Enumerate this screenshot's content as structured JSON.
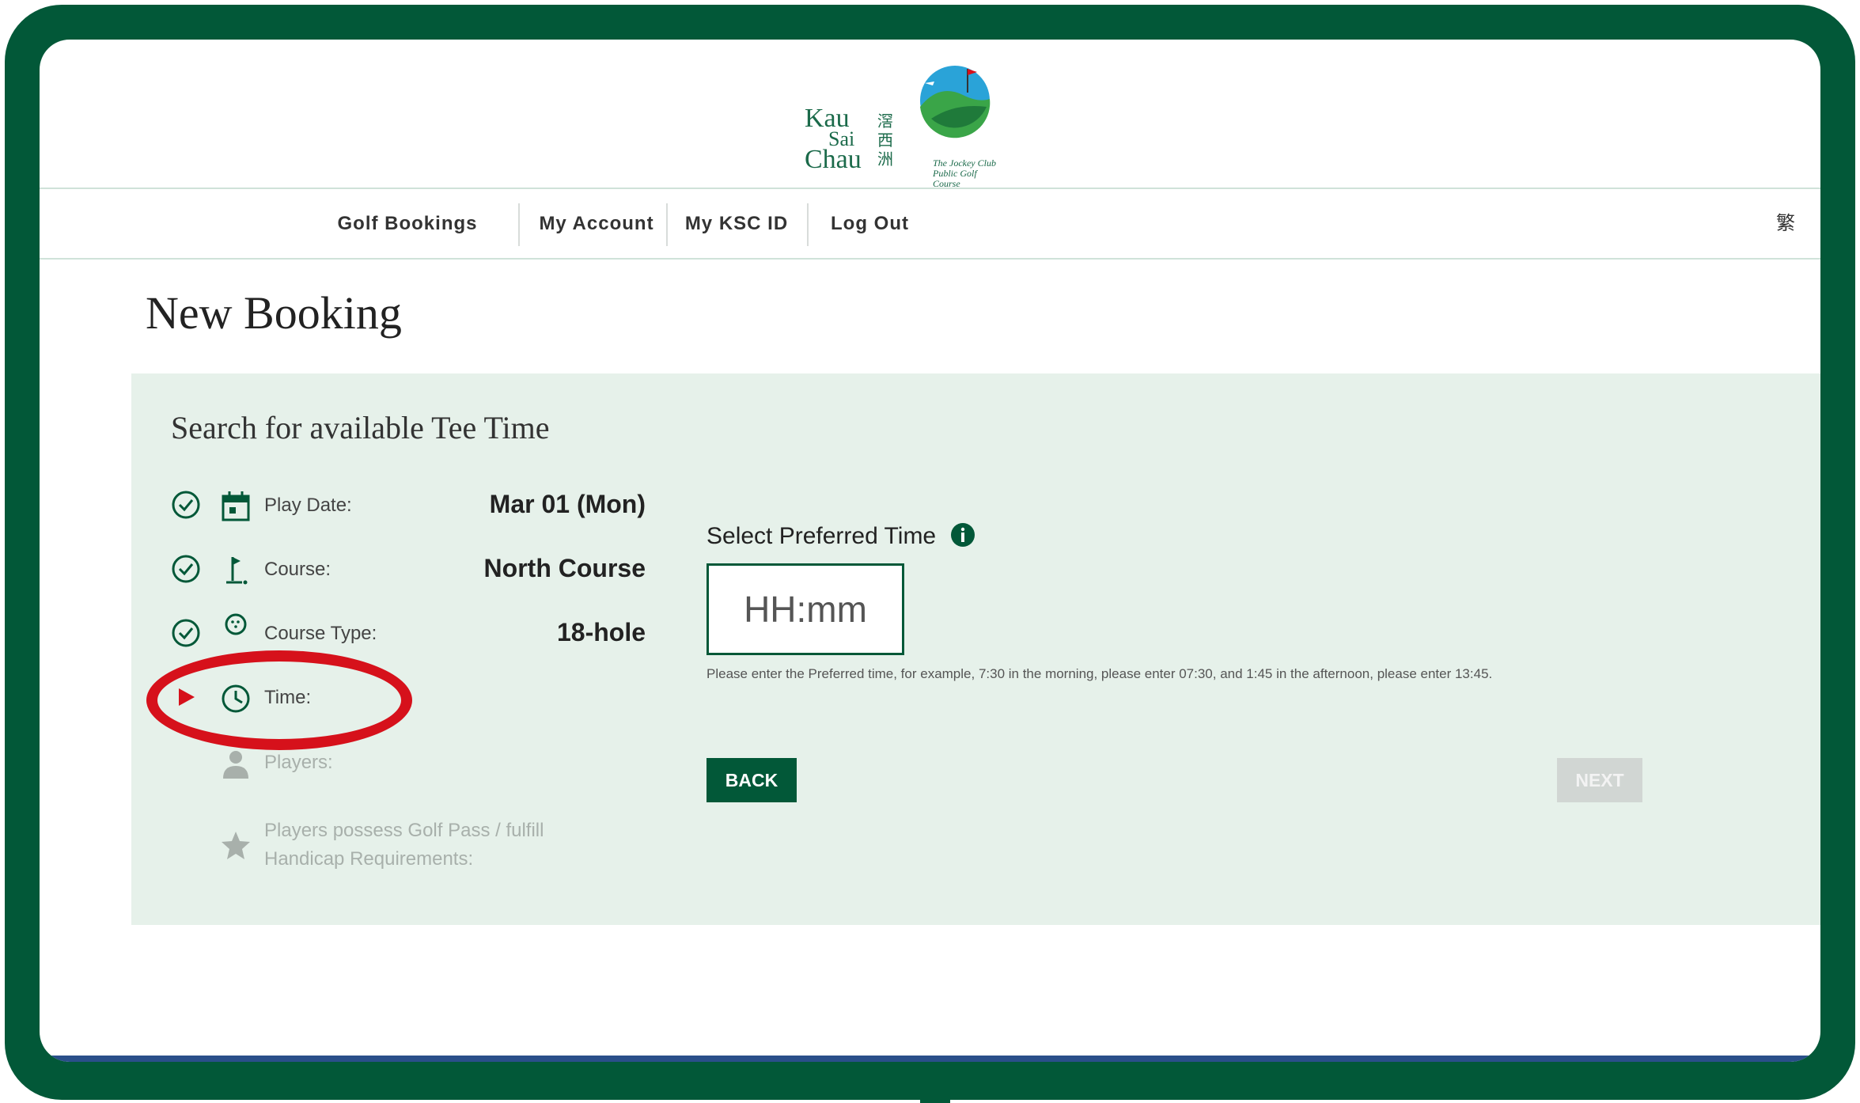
{
  "logo": {
    "name_line1": "Kau",
    "name_line2": "Sai",
    "name_line3": "Chau",
    "name_chinese": "滘西洲",
    "tagline": "The Jockey Club Public Golf Course"
  },
  "nav": {
    "items": [
      "Golf Bookings",
      "My Account",
      "My KSC ID",
      "Log Out"
    ],
    "language_toggle": "繁"
  },
  "page_title": "New Booking",
  "panel": {
    "title": "Search for available Tee Time",
    "steps": [
      {
        "label": "Play Date:",
        "value": "Mar 01 (Mon)",
        "status": "done",
        "icon": "calendar-icon"
      },
      {
        "label": "Course:",
        "value": "North Course",
        "status": "done",
        "icon": "flag-icon"
      },
      {
        "label": "Course Type:",
        "value": "18-hole",
        "status": "done",
        "icon": "golf-ball-icon"
      },
      {
        "label": "Time:",
        "value": "",
        "status": "current",
        "icon": "clock-icon"
      },
      {
        "label": "Players:",
        "value": "",
        "status": "pending",
        "icon": "person-icon"
      },
      {
        "label": "Players possess Golf Pass / fulfill Handicap Requirements:",
        "value": "",
        "status": "pending",
        "icon": "star-icon"
      }
    ],
    "preferred_time": {
      "label": "Select Preferred Time",
      "placeholder": "HH:mm",
      "hint": "Please enter the Preferred time, for example, 7:30 in the morning, please enter 07:30, and 1:45 in the afternoon, please enter 13:45."
    },
    "back_label": "BACK",
    "next_label": "NEXT"
  },
  "colors": {
    "brand_green": "#025838",
    "panel_bg": "#e6f1ea",
    "annotation_red": "#d6111b"
  }
}
